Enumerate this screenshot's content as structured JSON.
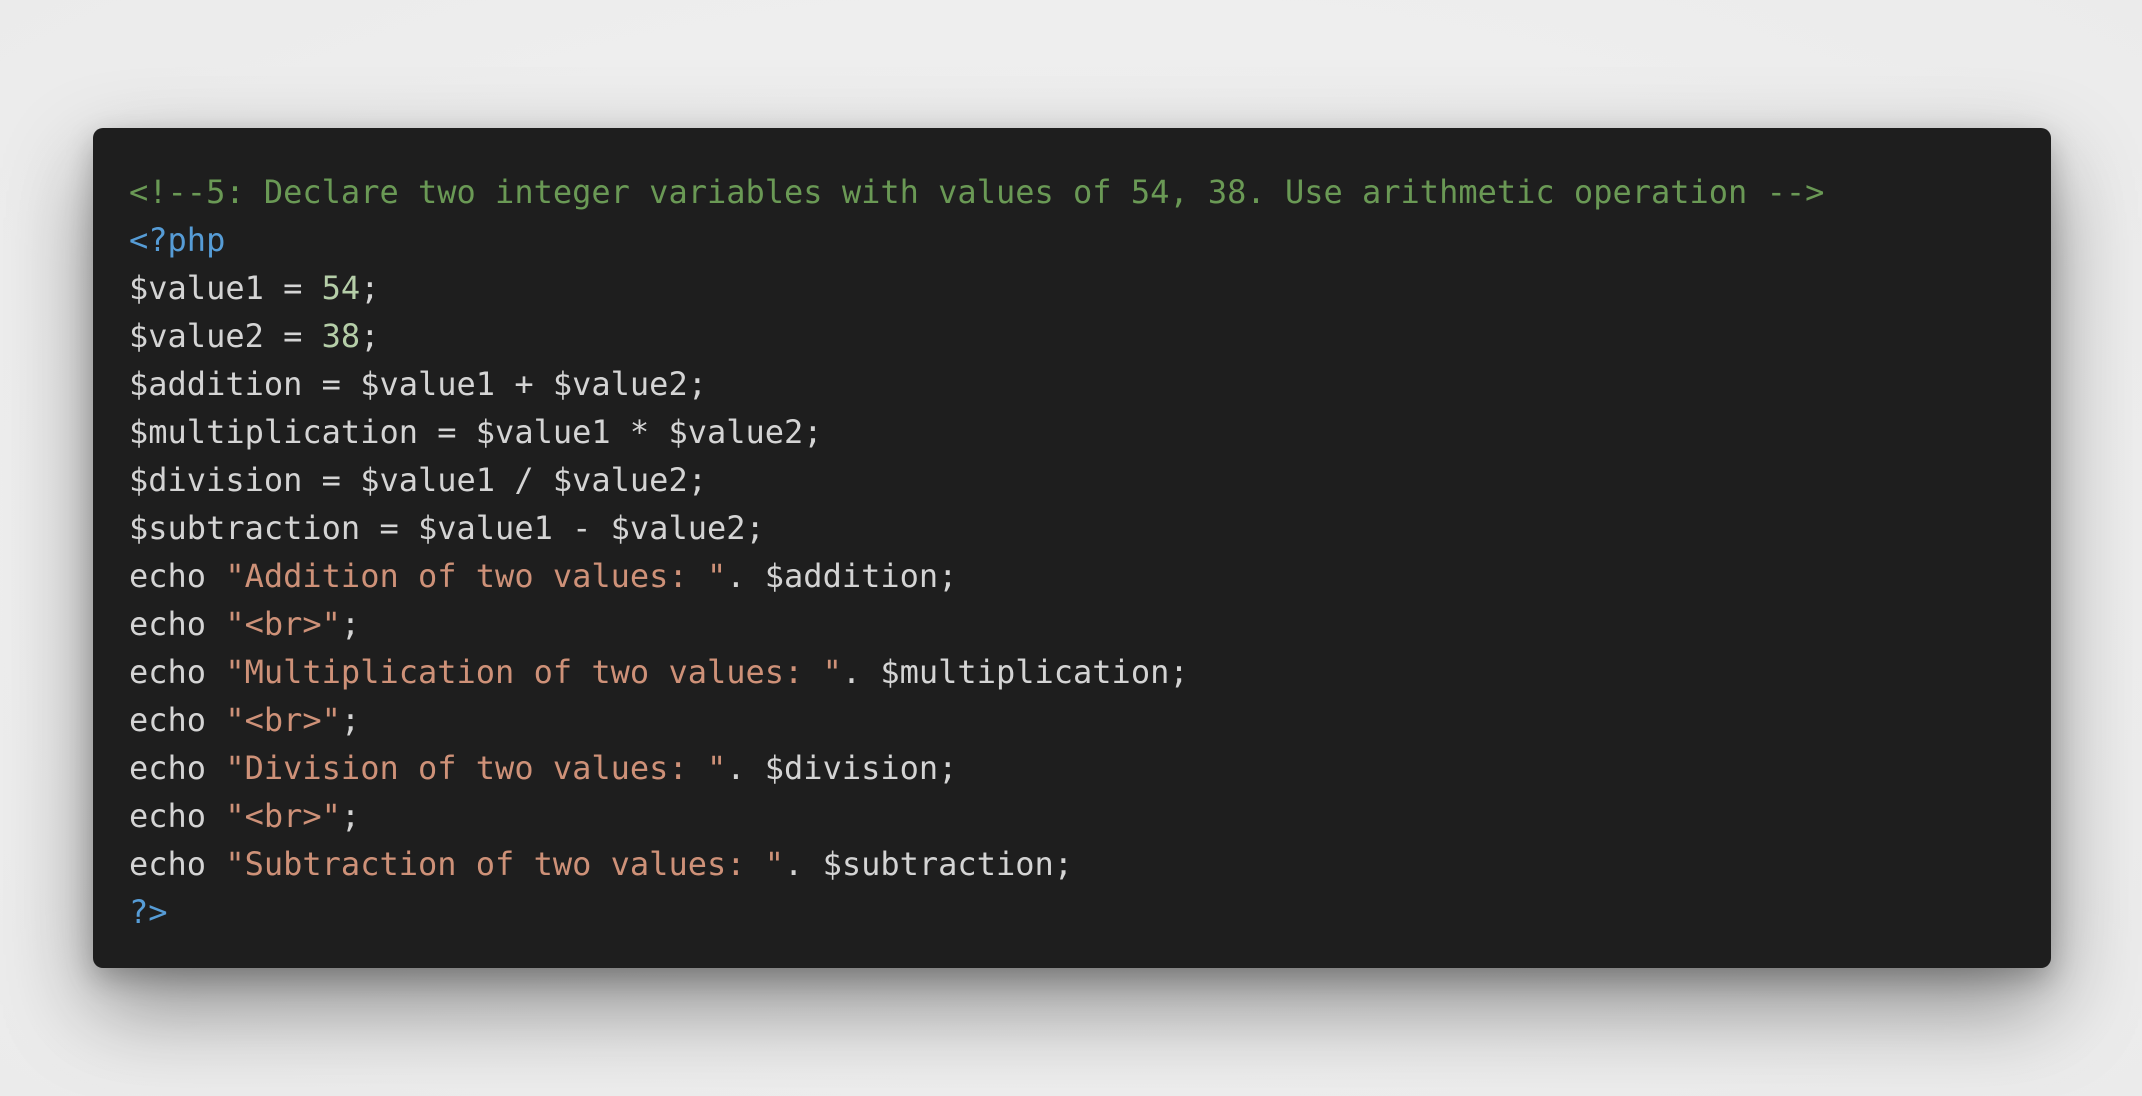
{
  "code_lines": [
    [
      {
        "t": "<!--5: Declare two integer variables with values of 54, 38. Use arithmetic operation -->",
        "k": "comment"
      }
    ],
    [
      {
        "t": "<?php",
        "k": "tag"
      }
    ],
    [
      {
        "t": "$value1 = ",
        "k": "plain"
      },
      {
        "t": "54",
        "k": "number"
      },
      {
        "t": ";",
        "k": "plain"
      }
    ],
    [
      {
        "t": "$value2 = ",
        "k": "plain"
      },
      {
        "t": "38",
        "k": "number"
      },
      {
        "t": ";",
        "k": "plain"
      }
    ],
    [
      {
        "t": "$addition = $value1 + $value2;",
        "k": "plain"
      }
    ],
    [
      {
        "t": "$multiplication = $value1 * $value2;",
        "k": "plain"
      }
    ],
    [
      {
        "t": "$division = $value1 / $value2;",
        "k": "plain"
      }
    ],
    [
      {
        "t": "$subtraction = $value1 - $value2;",
        "k": "plain"
      }
    ],
    [
      {
        "t": "echo ",
        "k": "plain"
      },
      {
        "t": "\"Addition of two values: \"",
        "k": "string"
      },
      {
        "t": ". $addition;",
        "k": "plain"
      }
    ],
    [
      {
        "t": "echo ",
        "k": "plain"
      },
      {
        "t": "\"<br>\"",
        "k": "string"
      },
      {
        "t": ";",
        "k": "plain"
      }
    ],
    [
      {
        "t": "echo ",
        "k": "plain"
      },
      {
        "t": "\"Multiplication of two values: \"",
        "k": "string"
      },
      {
        "t": ". $multiplication;",
        "k": "plain"
      }
    ],
    [
      {
        "t": "echo ",
        "k": "plain"
      },
      {
        "t": "\"<br>\"",
        "k": "string"
      },
      {
        "t": ";",
        "k": "plain"
      }
    ],
    [
      {
        "t": "echo ",
        "k": "plain"
      },
      {
        "t": "\"Division of two values: \"",
        "k": "string"
      },
      {
        "t": ". $division;",
        "k": "plain"
      }
    ],
    [
      {
        "t": "echo ",
        "k": "plain"
      },
      {
        "t": "\"<br>\"",
        "k": "string"
      },
      {
        "t": ";",
        "k": "plain"
      }
    ],
    [
      {
        "t": "echo ",
        "k": "plain"
      },
      {
        "t": "\"Subtraction of two values: \"",
        "k": "string"
      },
      {
        "t": ". $subtraction;",
        "k": "plain"
      }
    ],
    [
      {
        "t": "?>",
        "k": "tag"
      }
    ]
  ],
  "colors": {
    "page_background": "#eeeeee",
    "editor_background": "#1e1e1e",
    "comment": "#6a9955",
    "tag": "#569cd6",
    "number": "#b5cea8",
    "string": "#ce9178",
    "plain": "#d4d4d4"
  }
}
